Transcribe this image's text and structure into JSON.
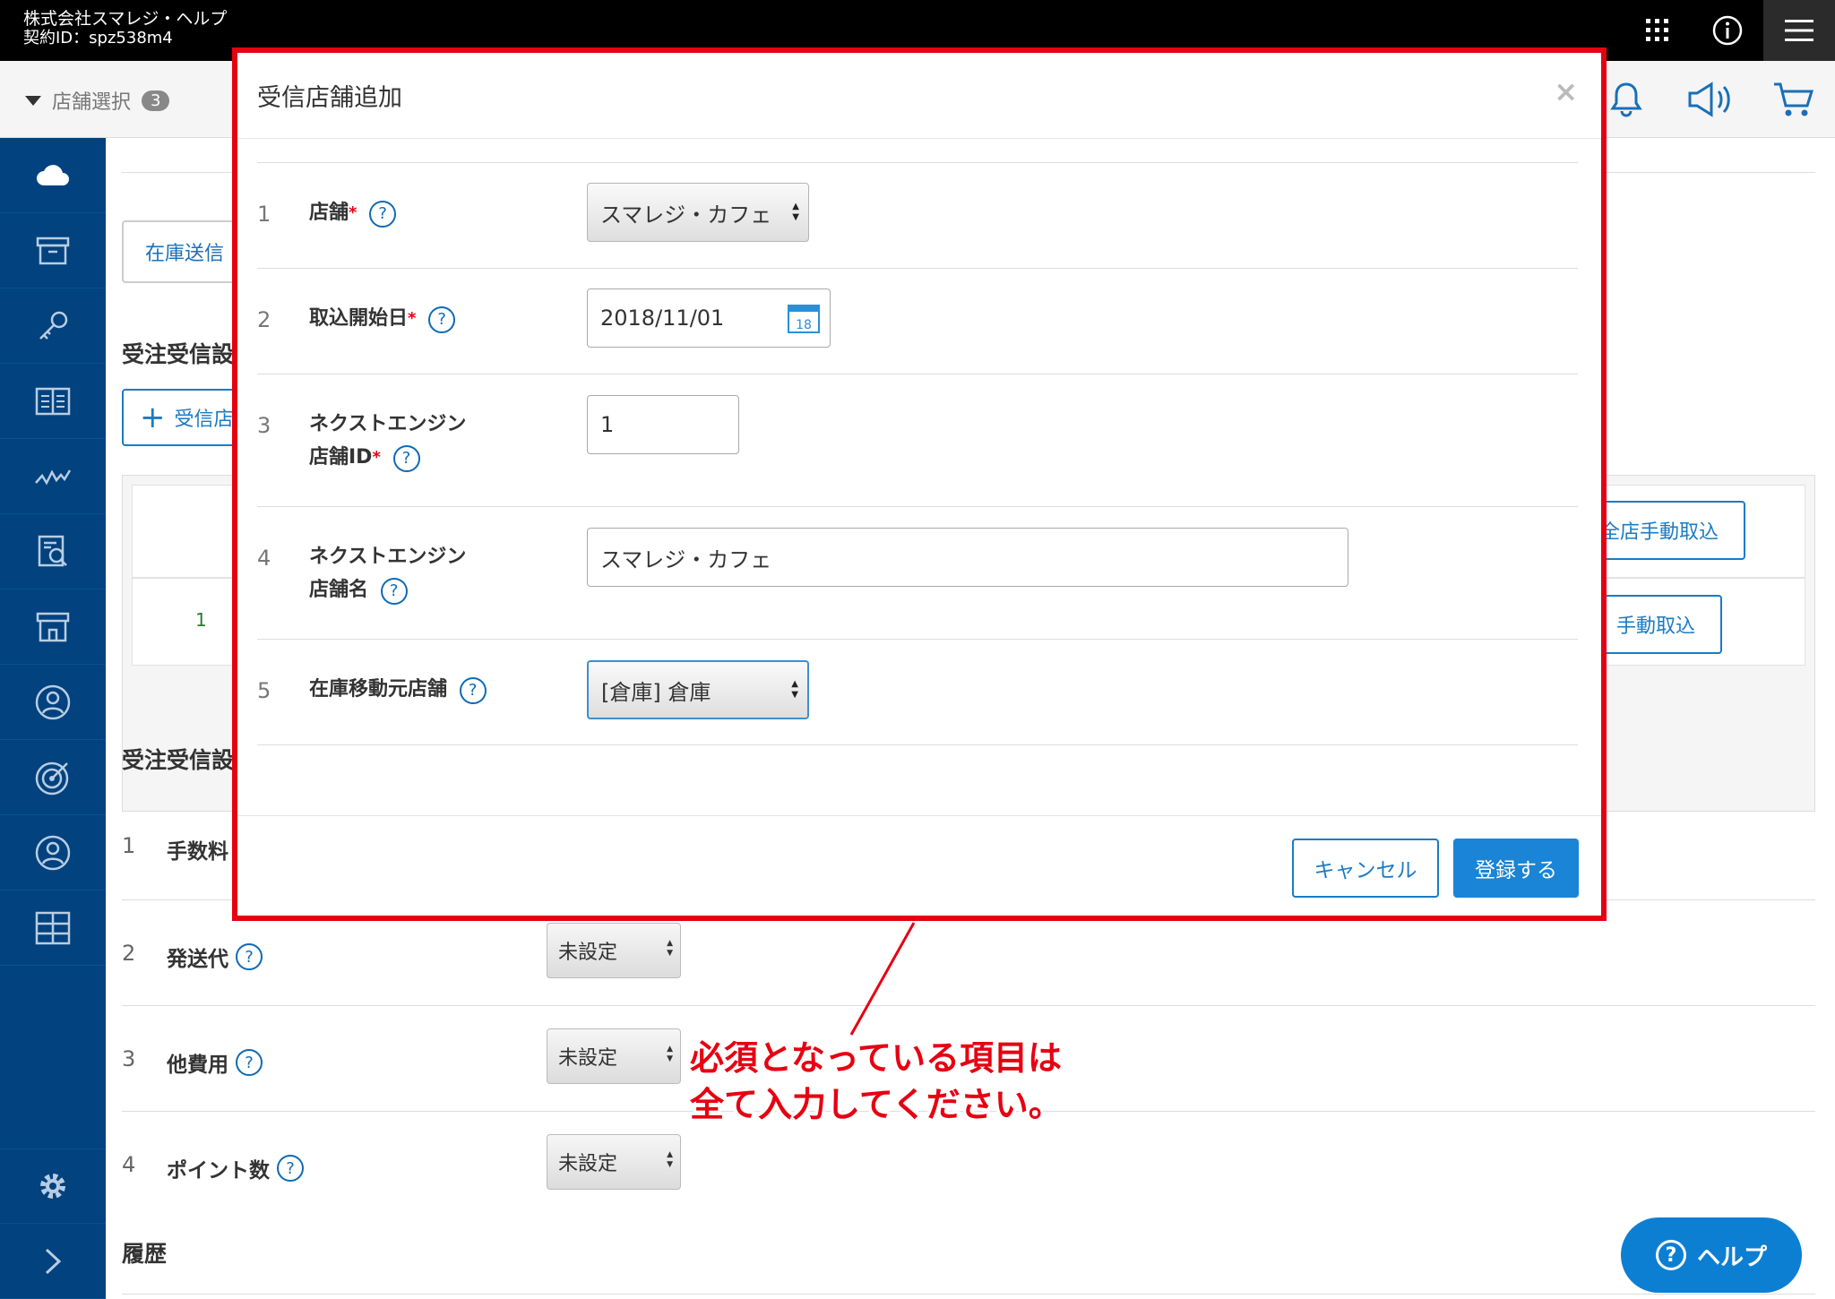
{
  "topbar": {
    "company": "株式会社スマレジ・ヘルプ",
    "contract": "契約ID：spz538m4"
  },
  "subbar": {
    "store_select_label": "店舗選択",
    "store_count": "3"
  },
  "background": {
    "tab_label": "在庫送信",
    "section1_title": "受注受信設",
    "add_button_label": "受信店",
    "table_row_num": "1",
    "all_manual_button": "全店手動取込",
    "manual_button": "手動取込",
    "section2_title": "受注受信設",
    "rows": [
      {
        "num": "1",
        "label": "手数料"
      },
      {
        "num": "2",
        "label": "発送代",
        "value": "未設定"
      },
      {
        "num": "3",
        "label": "他費用",
        "value": "未設定"
      },
      {
        "num": "4",
        "label": "ポイント数",
        "value": "未設定"
      }
    ],
    "history_title": "履歴"
  },
  "modal": {
    "title": "受信店舗追加",
    "close": "×",
    "rows": [
      {
        "num": "1",
        "label": "店舗",
        "required": "*",
        "value": "スマレジ・カフェ"
      },
      {
        "num": "2",
        "label": "取込開始日",
        "required": "*",
        "value": "2018/11/01",
        "calendar_day": "18"
      },
      {
        "num": "3",
        "label_line1": "ネクストエンジン",
        "label_line2": "店舗ID",
        "required": "*",
        "value": "1"
      },
      {
        "num": "4",
        "label_line1": "ネクストエンジン",
        "label_line2": "店舗名",
        "value": "スマレジ・カフェ"
      },
      {
        "num": "5",
        "label": "在庫移動元店舗",
        "value": "[倉庫] 倉庫"
      }
    ],
    "help_mark": "?",
    "cancel_label": "キャンセル",
    "submit_label": "登録する"
  },
  "annotation": {
    "line1": "必須となっている項目は",
    "line2": "全て入力してください。"
  },
  "help_button": {
    "mark": "?",
    "label": "ヘルプ"
  },
  "colors": {
    "sidebar": "#01427f",
    "accent": "#1a84d6",
    "highlight_red": "#e60012"
  }
}
